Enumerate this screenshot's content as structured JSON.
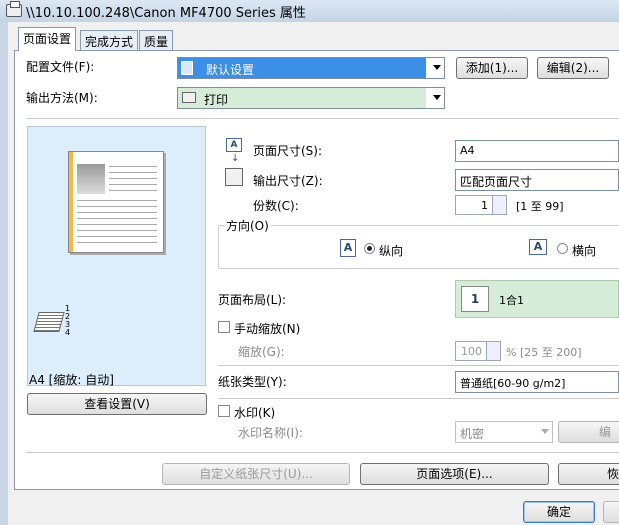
{
  "window": {
    "title": "\\\\10.10.100.248\\Canon MF4700 Series 属性"
  },
  "tabs": [
    "页面设置",
    "完成方式",
    "质量"
  ],
  "profile": {
    "label": "配置文件(F):",
    "value": "默认设置",
    "add": "添加(1)...",
    "edit": "编辑(2)..."
  },
  "output": {
    "label": "输出方法(M):",
    "value": "打印"
  },
  "preview": {
    "caption": "A4 [缩放: 自动]",
    "view_button": "查看设置(V)"
  },
  "page_size": {
    "label": "页面尺寸(S):",
    "value": "A4"
  },
  "output_size": {
    "label": "输出尺寸(Z):",
    "value": "匹配页面尺寸"
  },
  "copies": {
    "label": "份数(C):",
    "value": "1",
    "range": "[1 至 99]"
  },
  "orientation": {
    "label": "方向(O)",
    "portrait": "纵向",
    "landscape": "横向",
    "icon_letter": "A"
  },
  "layout": {
    "label": "页面布局(L):",
    "number": "1",
    "value": "1合1"
  },
  "manual_scale": {
    "label": "手动缩放(N)",
    "scale_label": "缩放(G):",
    "value": "100",
    "range": "% [25 至 200]"
  },
  "paper_type": {
    "label": "纸张类型(Y):",
    "value": "普通纸[60-90 g/m2]"
  },
  "watermark": {
    "label": "水印(K)",
    "name_label": "水印名称(I):",
    "value": "机密",
    "edit_partial": "编"
  },
  "bottom": {
    "custom_size": "自定义纸张尺寸(U)...",
    "page_options": "页面选项(E)...",
    "restore_partial": "恢"
  },
  "footer": {
    "ok": "确定"
  }
}
